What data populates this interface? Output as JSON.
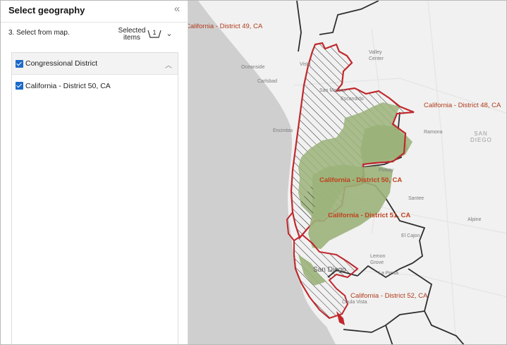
{
  "panel": {
    "title": "Select geography",
    "step": "3.  Select from map.",
    "selected_label_line1": "Selected",
    "selected_label_line2": "items",
    "selected_count": "1",
    "group_label": "Congressional District",
    "items": [
      {
        "label": "California - District 50, CA",
        "checked": true
      }
    ],
    "group_checked": true,
    "accent_color": "#1b6ac9"
  },
  "map": {
    "district_labels": {
      "d49": "California - District 49, CA",
      "d48": "California - District 48, CA",
      "d50": "California - District 50, CA",
      "d51": "California - District 51, CA",
      "d52": "California - District 52, CA"
    },
    "places": {
      "oceanside": "Oceanside",
      "vista": "Vista",
      "valley_center_1": "Valley",
      "valley_center_2": "Center",
      "carlsbad": "Carlsbad",
      "san_marcos": "San Marcos",
      "escondido": "Escondido",
      "encinitas": "Encinitas",
      "ramona": "Ramona",
      "poway": "Poway",
      "santee": "Santee",
      "el_cajon": "El Cajon",
      "alpine": "Alpine",
      "lemon_grove_1": "Lemon",
      "lemon_grove_2": "Grove",
      "la_presa": "La Presa",
      "san_diego": "San Diego",
      "chula_vista": "Chula Vista",
      "san_diego_county_1": "SAN",
      "san_diego_county_2": "DIEGO"
    },
    "colors": {
      "ocean": "#cfcfcf",
      "land": "#f1f1f1",
      "selected_fill": "#9bb37a",
      "selected_outline": "#c0282d",
      "boundary": "#2e2e2e",
      "label": "#c0411c"
    }
  }
}
